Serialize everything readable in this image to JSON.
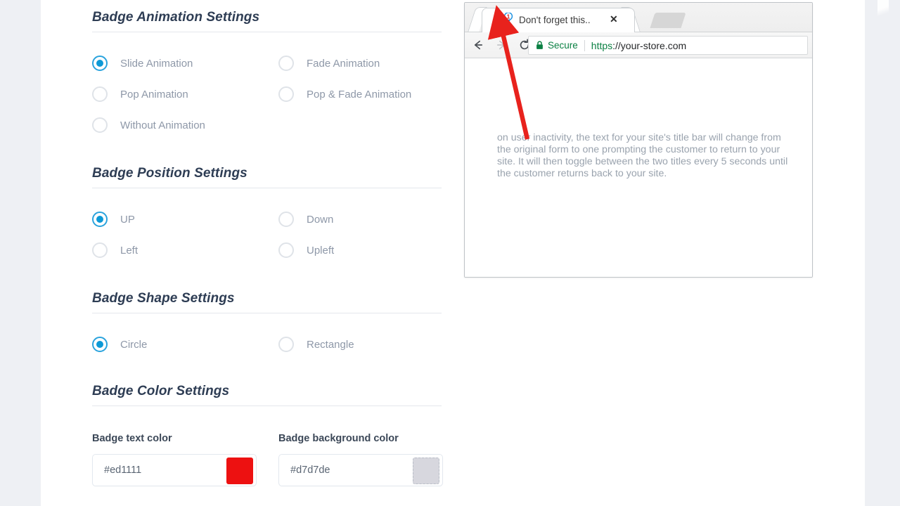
{
  "theme": {
    "page_bg": "#eef0f4",
    "content_bg": "#ffffff",
    "heading_color": "#2e3d54",
    "radio_accent": "#0d99d6",
    "secure_green": "#0b8043",
    "annotation_red": "#e8221d"
  },
  "settings": {
    "sections": [
      {
        "title": "Badge Animation Settings",
        "name": "badge-animation-settings",
        "rows": [
          [
            {
              "label": "Slide Animation",
              "checked": true
            },
            {
              "label": "Fade Animation",
              "checked": false
            }
          ],
          [
            {
              "label": "Pop Animation",
              "checked": false
            },
            {
              "label": "Pop & Fade Animation",
              "checked": false
            }
          ],
          [
            {
              "label": "Without Animation",
              "checked": false
            }
          ]
        ]
      },
      {
        "title": "Badge Position Settings",
        "name": "badge-position-settings",
        "rows": [
          [
            {
              "label": "UP",
              "checked": true
            },
            {
              "label": "Down",
              "checked": false
            }
          ],
          [
            {
              "label": "Left",
              "checked": false
            },
            {
              "label": "Upleft",
              "checked": false
            }
          ]
        ]
      },
      {
        "title": "Badge Shape Settings",
        "name": "badge-shape-settings",
        "rows": [
          [
            {
              "label": "Circle",
              "checked": true
            },
            {
              "label": "Rectangle",
              "checked": false
            }
          ]
        ]
      }
    ],
    "color_section": {
      "title": "Badge Color Settings",
      "fields": [
        {
          "label": "Badge text color",
          "value": "#ed1111",
          "swatch": "#ed1111",
          "dashed": false
        },
        {
          "label": "Badge background color",
          "value": "#d7d7de",
          "swatch": "#d7d7de",
          "dashed": true
        }
      ]
    }
  },
  "preview": {
    "browser": {
      "tab": {
        "title": "Don't forget this..",
        "close_label": "✕",
        "favicon_badge": "1"
      },
      "omnibox": {
        "security_label": "Secure",
        "url_scheme": "https",
        "url_rest": "://your-store.com"
      },
      "page_text": "on user inactivity, the text for your site's title bar will change from the original form to one prompting the customer to return to your site. It will then toggle between the two titles every 5 seconds until the customer returns back to your site."
    }
  }
}
